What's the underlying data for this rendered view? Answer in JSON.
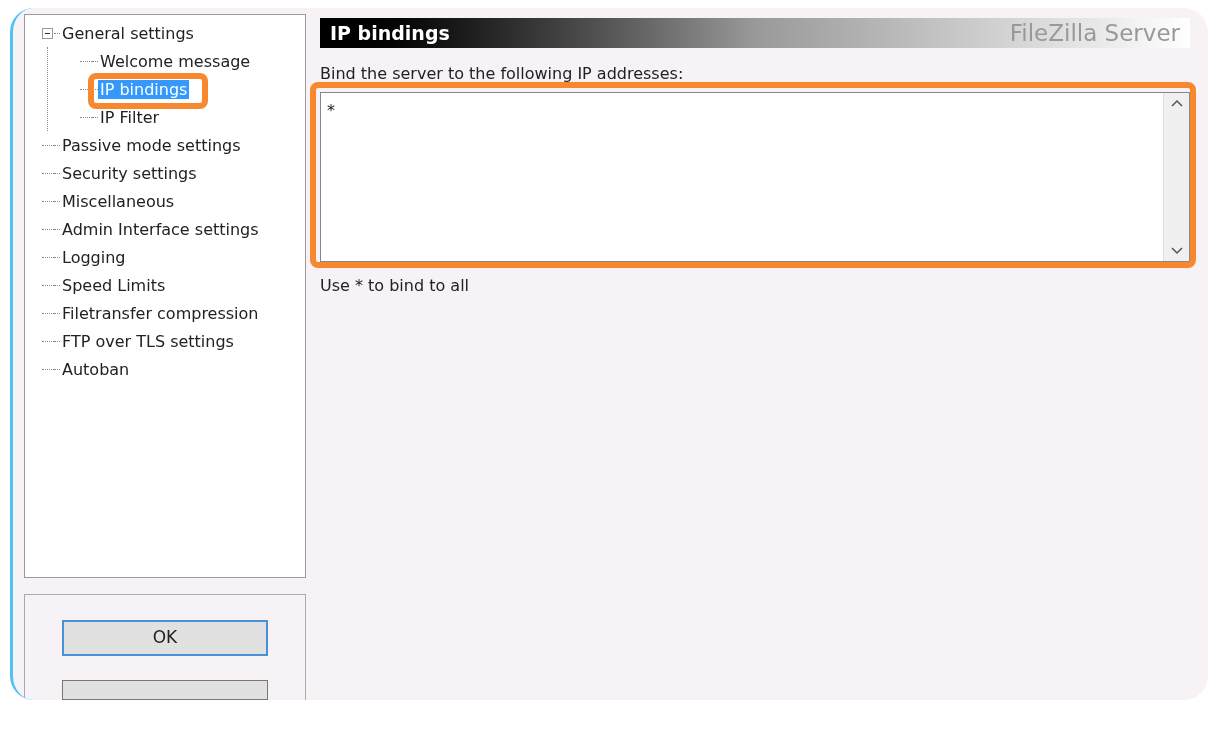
{
  "tree": [
    {
      "label": "General settings",
      "expanded": true,
      "selected": false,
      "children": [
        {
          "label": "Welcome message",
          "selected": false
        },
        {
          "label": "IP bindings",
          "selected": true
        },
        {
          "label": "IP Filter",
          "selected": false
        }
      ]
    },
    {
      "label": "Passive mode settings",
      "selected": false
    },
    {
      "label": "Security settings",
      "selected": false
    },
    {
      "label": "Miscellaneous",
      "selected": false
    },
    {
      "label": "Admin Interface settings",
      "selected": false
    },
    {
      "label": "Logging",
      "selected": false
    },
    {
      "label": "Speed Limits",
      "selected": false
    },
    {
      "label": "Filetransfer compression",
      "selected": false
    },
    {
      "label": "FTP over TLS settings",
      "selected": false
    },
    {
      "label": "Autoban",
      "selected": false
    }
  ],
  "buttons": [
    "OK"
  ],
  "page": {
    "title": "IP bindings",
    "brand": "FileZilla Server",
    "field_label": "Bind the server to the following IP addresses:",
    "field_value": "*",
    "hint": "Use * to bind to all"
  }
}
